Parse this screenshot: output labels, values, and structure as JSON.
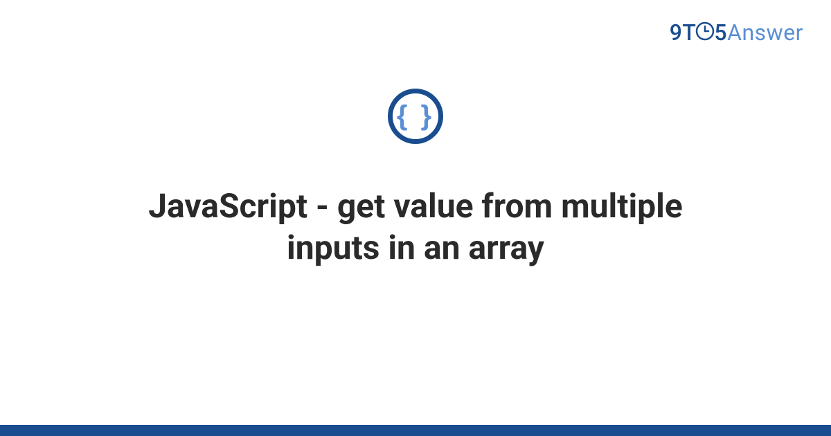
{
  "logo": {
    "part1": "9T",
    "part2": "5",
    "part3": "Answer"
  },
  "badge": {
    "symbol": "{ }",
    "icon_name": "code-braces-icon"
  },
  "title": "JavaScript - get value from multiple inputs in an array",
  "colors": {
    "primary": "#1a4d8f",
    "accent": "#5a8fd4",
    "text": "#2a2a2a"
  }
}
